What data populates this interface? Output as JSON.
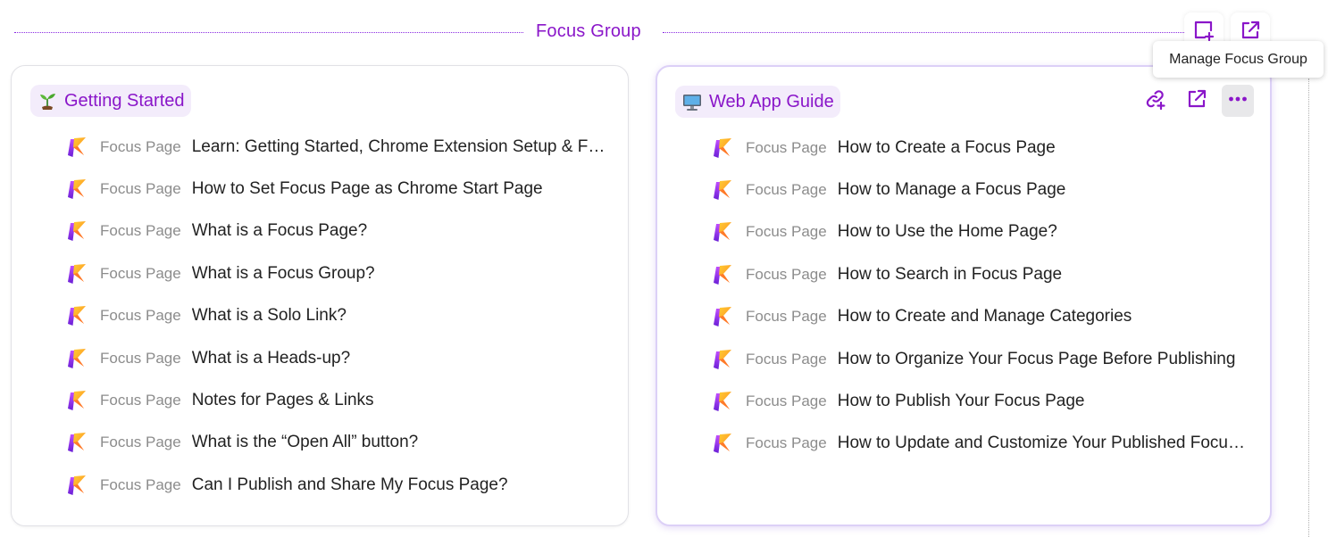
{
  "header": {
    "title": "Focus Group",
    "tooltip": "Manage Focus Group",
    "icons": [
      "add-page-icon",
      "open-external-icon"
    ]
  },
  "colors": {
    "accent": "#8a16c9",
    "pill_bg": "#f3ecfb",
    "muted_text": "#8c8c8c"
  },
  "cards": [
    {
      "title": "Getting Started",
      "emoji_icon": "seedling-icon",
      "source_label": "Focus Page",
      "items": [
        "Learn: Getting Started, Chrome Extension Setup & Focus Page Basics",
        "How to Set Focus Page as Chrome Start Page",
        "What is a Focus Page?",
        "What is a Focus Group?",
        "What is a Solo Link?",
        "What is a Heads-up?",
        "Notes for Pages & Links",
        "What is the “Open All” button?",
        "Can I Publish and Share My Focus Page?"
      ]
    },
    {
      "title": "Web App Guide",
      "emoji_icon": "desktop-computer-icon",
      "source_label": "Focus Page",
      "actions": [
        "add-link-icon",
        "open-external-icon",
        "more-options-icon"
      ],
      "items": [
        "How to Create a Focus Page",
        "How to Manage a Focus Page",
        "How to Use the Home Page?",
        "How to Search in Focus Page",
        "How to Create and Manage Categories",
        "How to Organize Your Focus Page Before Publishing",
        "How to Publish Your Focus Page",
        "How to Update and Customize Your Published Focus Page"
      ]
    }
  ]
}
